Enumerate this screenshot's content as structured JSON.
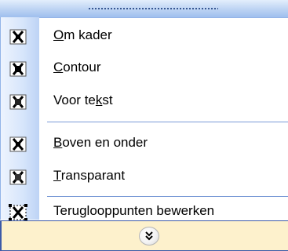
{
  "menu": {
    "items": [
      {
        "id": "om-kader",
        "prefix": "",
        "accel": "O",
        "suffix": "m kader",
        "icon": "wrap-square-icon"
      },
      {
        "id": "contour",
        "prefix": "",
        "accel": "C",
        "suffix": "ontour",
        "icon": "wrap-tight-icon"
      },
      {
        "id": "voor-tekst",
        "prefix": "Voor te",
        "accel": "k",
        "suffix": "st",
        "icon": "wrap-in-front-icon"
      },
      {
        "id": "boven-en-onder",
        "prefix": "",
        "accel": "B",
        "suffix": "oven en onder",
        "icon": "wrap-top-bottom-icon"
      },
      {
        "id": "transparant",
        "prefix": "",
        "accel": "T",
        "suffix": "ransparant",
        "icon": "wrap-behind-icon"
      },
      {
        "id": "teruglooppunten",
        "prefix": "Teru",
        "accel": "g",
        "suffix": "looppunten bewerken",
        "icon": "edit-wrap-points-icon"
      }
    ],
    "expand_icon": "chevron-double-down-icon"
  },
  "colors": {
    "accent_border": "#3c5aa8",
    "expand_bg": "#fdf1cc",
    "icon_strip": "#d6e5fb"
  }
}
